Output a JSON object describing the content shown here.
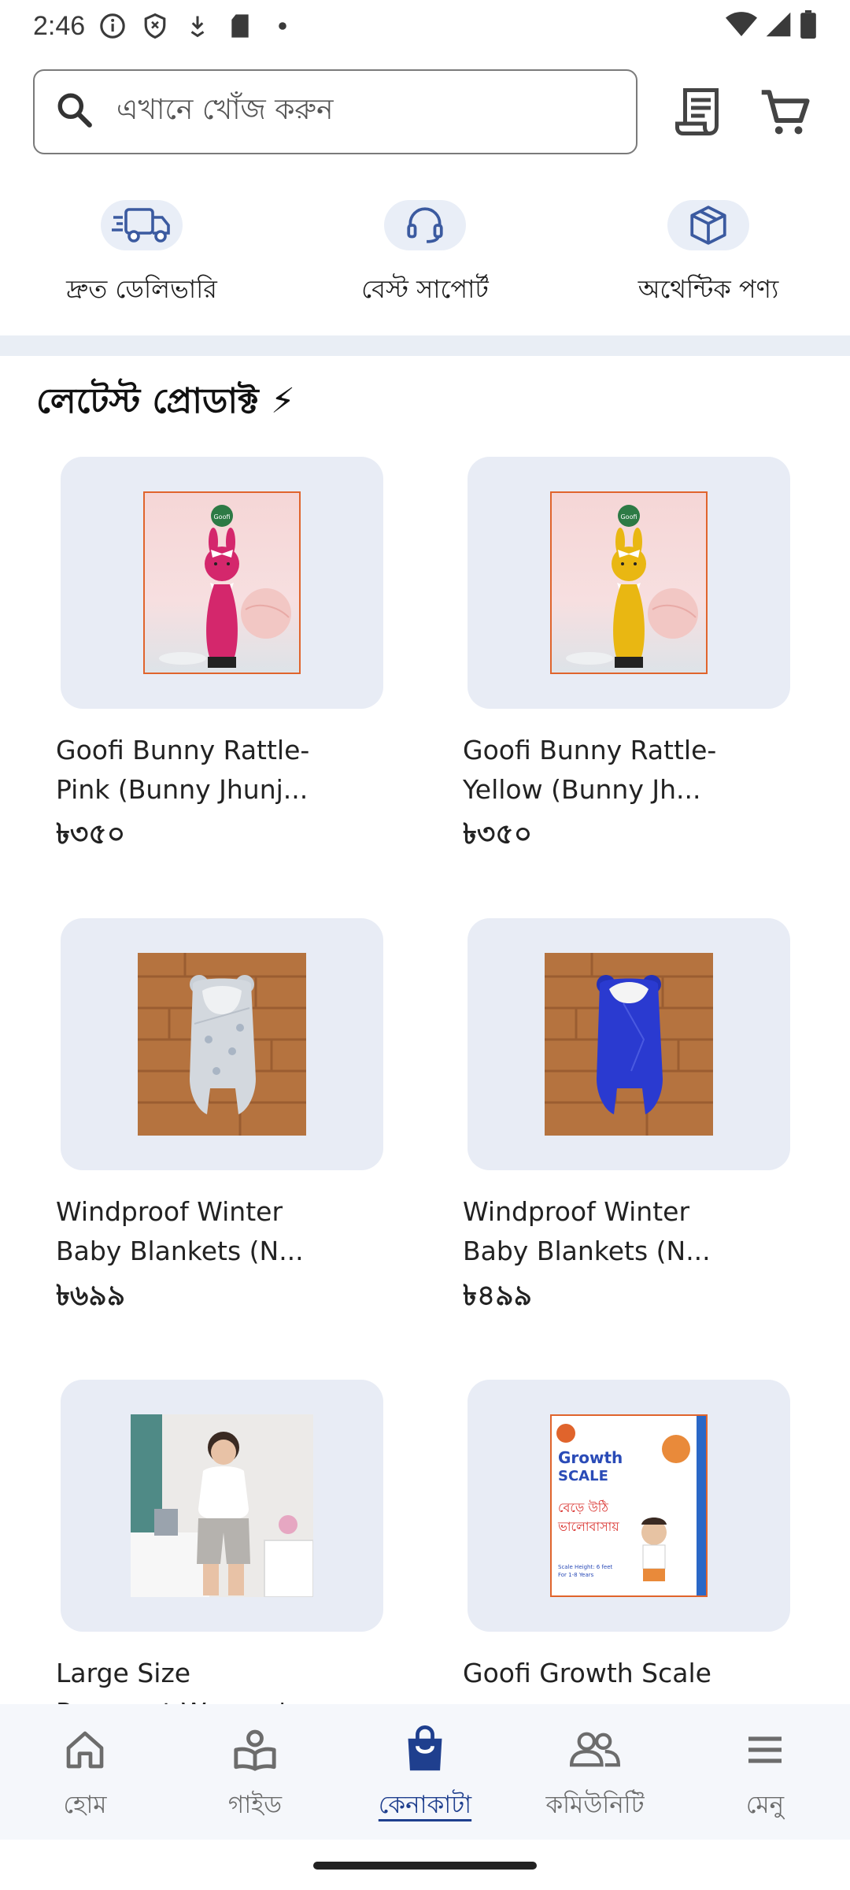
{
  "status_bar": {
    "time": "2:46"
  },
  "search": {
    "placeholder": "এখানে খোঁজ করুন"
  },
  "features": [
    {
      "label": "দ্রুত ডেলিভারি",
      "icon": "truck-icon"
    },
    {
      "label": "বেস্ট সাপোর্ট",
      "icon": "headset-icon"
    },
    {
      "label": "অথেন্টিক পণ্য",
      "icon": "box-icon"
    }
  ],
  "section": {
    "title": "লেটেস্ট প্রোডাক্ট ⚡"
  },
  "products": [
    {
      "name_line1": "Goofi Bunny Rattle-",
      "name_line2": "Pink (Bunny Jhunj...",
      "price": "৳৩৫০",
      "logo_text": "Goofi"
    },
    {
      "name_line1": "Goofi Bunny Rattle-",
      "name_line2": "Yellow (Bunny Jh...",
      "price": "৳৩৫০",
      "logo_text": "Goofi"
    },
    {
      "name_line1": "Windproof Winter",
      "name_line2": "Baby Blankets (N...",
      "price": "৳৬৯৯"
    },
    {
      "name_line1": "Windproof Winter",
      "name_line2": "Baby Blankets (N...",
      "price": "৳৪৯৯"
    },
    {
      "name_line1": "Large Size",
      "name_line2": "Pregnant Women'...",
      "price": ""
    },
    {
      "name_line1": "Goofi Growth Scale",
      "name_line2": "",
      "price": "",
      "poster": {
        "brand_1": "Growth",
        "brand_2": "SCALE",
        "bangla_1": "বেড়ে উঠি",
        "bangla_2": "ভালোবাসায়",
        "note_1": "Scale Height: 6 feet",
        "note_2": "For 1-8 Years"
      }
    }
  ],
  "bottom_nav": [
    {
      "label": "হোম",
      "icon": "home-icon",
      "active": false
    },
    {
      "label": "গাইড",
      "icon": "guide-icon",
      "active": false
    },
    {
      "label": "কেনাকাটা",
      "icon": "shopping-bag-icon",
      "active": true
    },
    {
      "label": "কমিউনিটি",
      "icon": "community-icon",
      "active": false
    },
    {
      "label": "মেনু",
      "icon": "menu-icon",
      "active": false
    }
  ],
  "colors": {
    "accent": "#1f3f8e",
    "feature_bg": "#e9eef7",
    "card_bg": "#e8ecf5",
    "nav_bg": "#f5f7fb"
  }
}
